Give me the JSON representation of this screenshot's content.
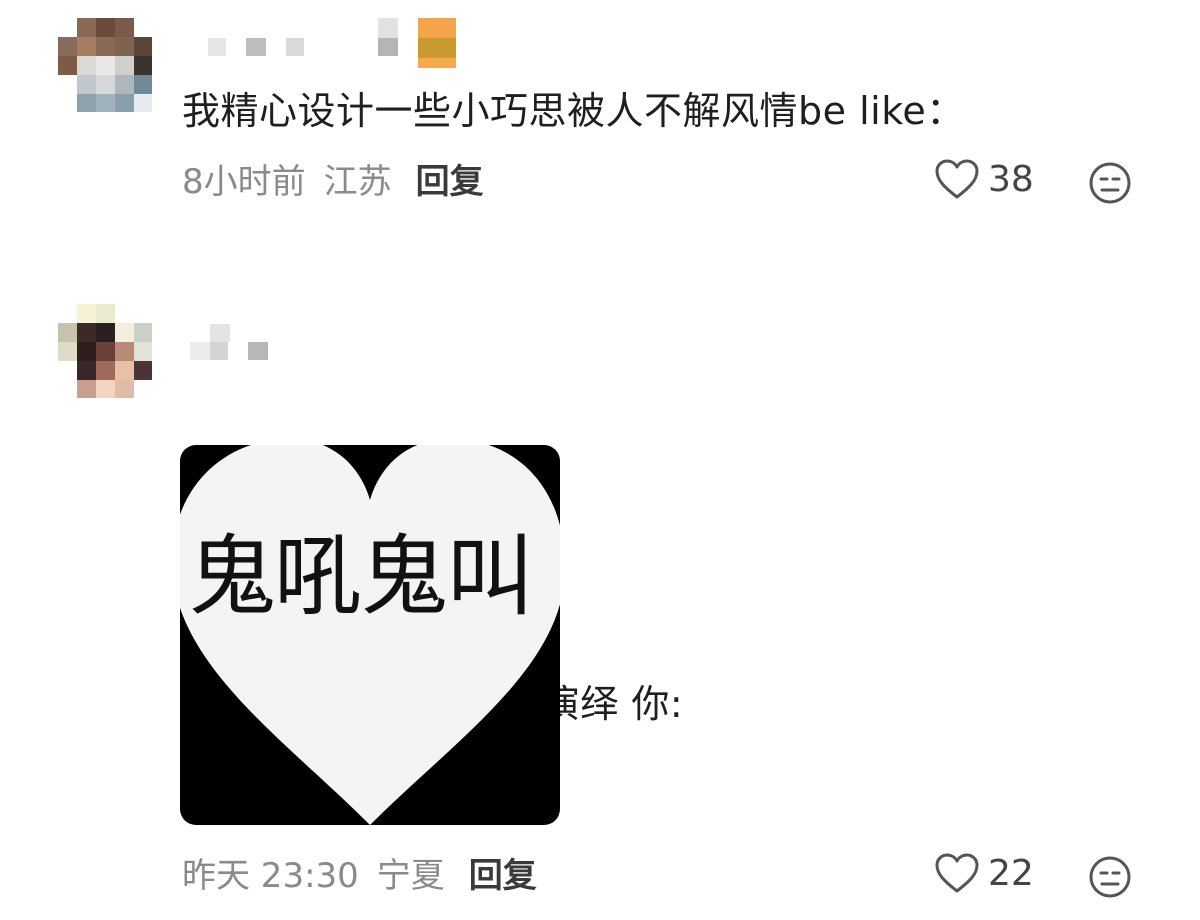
{
  "comments": [
    {
      "text": "我精心设计一些小巧思被人不解风情be like：",
      "time": "8小时前",
      "location": "江苏",
      "reply_label": "回复",
      "likes": "38"
    },
    {
      "text": "百词斩:贴心的情景小演绎 你:",
      "image_caption": "鬼吼鬼叫",
      "time": "昨天 23:30",
      "location": "宁夏",
      "reply_label": "回复",
      "likes": "22"
    }
  ],
  "icons": {
    "like": "heart-outline-icon",
    "reaction": "neutral-face-icon"
  },
  "colors": {
    "text": "#1f1f1f",
    "meta": "#8a8a8a",
    "reply": "#3a3a3a",
    "meme_bg": "#000000",
    "heart_fill": "#f4f4f4"
  }
}
